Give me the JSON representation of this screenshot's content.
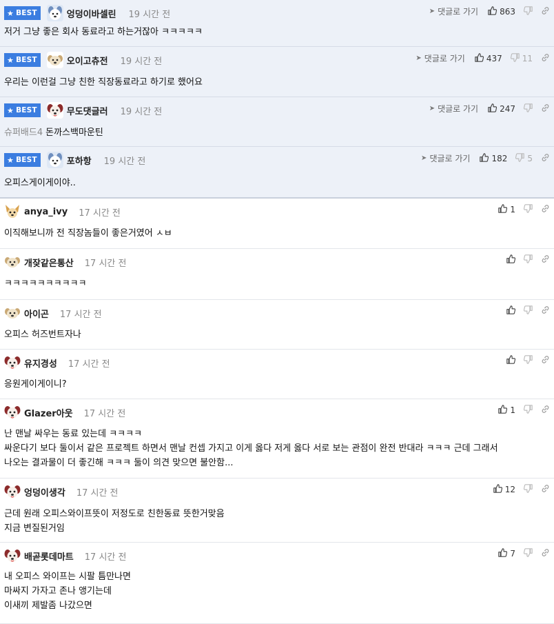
{
  "labels": {
    "best": "BEST",
    "reply_link": "댓글로 가기"
  },
  "comments": [
    {
      "nick": "엉덩이바셀린",
      "time": "19 시간 전",
      "best": true,
      "avatar": "dog-blue-avatar",
      "lines": [
        "저거 그냥 좋은 회사 동료라고 하는거잖아 ㅋㅋㅋㅋㅋ"
      ],
      "up": "863",
      "down": ""
    },
    {
      "nick": "오이고츄전",
      "time": "19 시간 전",
      "best": true,
      "avatar": "dog-cream-avatar",
      "lines": [
        "우리는 이런걸 그냥 친한 직장동료라고 하기로 했어요"
      ],
      "up": "437",
      "down": "11"
    },
    {
      "nick": "무도댓글러",
      "time": "19 시간 전",
      "best": true,
      "avatar": "dog-red-avatar",
      "prefix": "슈퍼배드4",
      "lines": [
        "돈까스백마운틴"
      ],
      "up": "247",
      "down": ""
    },
    {
      "nick": "포하항",
      "time": "19 시간 전",
      "best": true,
      "avatar": "dog-blue-avatar",
      "lines": [
        "오피스게이게이야.."
      ],
      "up": "182",
      "down": "5"
    },
    {
      "nick": "anya_ivy",
      "time": "17 시간 전",
      "best": false,
      "avatar": "chihuahua-avatar",
      "lines": [
        "이직해보니까 전 직장놈들이 좋은거였어 ㅅㅂ"
      ],
      "up": "1",
      "down": ""
    },
    {
      "nick": "개잦같은통산",
      "time": "17 시간 전",
      "best": false,
      "avatar": "dog-cream-avatar",
      "lines": [
        "ㅋㅋㅋㅋㅋㅋㅋㅋㅋㅋ"
      ],
      "up": "",
      "down": ""
    },
    {
      "nick": "아이곤",
      "time": "17 시간 전",
      "best": false,
      "avatar": "dog-cream-avatar",
      "lines": [
        "오피스 허즈번트자나"
      ],
      "up": "",
      "down": ""
    },
    {
      "nick": "유지경성",
      "time": "17 시간 전",
      "best": false,
      "avatar": "dog-red-avatar",
      "lines": [
        "응원게이게이니?"
      ],
      "up": "",
      "down": ""
    },
    {
      "nick": "Glazer아웃",
      "time": "17 시간 전",
      "best": false,
      "avatar": "dog-red-avatar",
      "lines": [
        "난 맨날 싸우는 동료 있는데 ㅋㅋㅋㅋ",
        "싸운다기 보다 둘이서 같은 프로젝트 하면서 맨날 컨셉 가지고 이게 옳다 저게 옳다 서로 보는 관점이 완전 반대라 ㅋㅋㅋ 근데 그래서",
        "나오는 결과물이 더 좋긴해 ㅋㅋㅋ 둘이 의견 맞으면 불안함..."
      ],
      "up": "1",
      "down": ""
    },
    {
      "nick": "엉덩이생각",
      "time": "17 시간 전",
      "best": false,
      "avatar": "dog-red-avatar",
      "lines": [
        "근데 원래 오피스와이프뜻이 저정도로 친한동료 뜻한거맞음",
        "지금 변질된거임"
      ],
      "up": "12",
      "down": ""
    },
    {
      "nick": "배곧롯데마트",
      "time": "17 시간 전",
      "best": false,
      "avatar": "dog-red-avatar",
      "lines": [
        "내 오피스 와이프는 시팔 틈만나면",
        "마싸지 가자고 존나 앵기는데",
        "이새끼 제발좀 나갔으면"
      ],
      "up": "7",
      "down": ""
    }
  ]
}
